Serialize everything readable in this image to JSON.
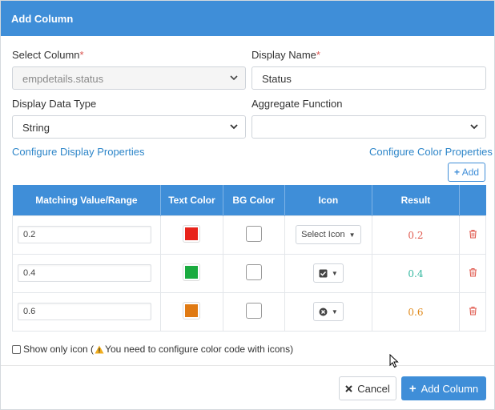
{
  "dialog": {
    "title": "Add Column"
  },
  "form": {
    "select_column_label": "Select Column",
    "select_column_value": "empdetails.status",
    "display_name_label": "Display Name",
    "display_name_value": "Status",
    "display_data_type_label": "Display Data Type",
    "display_data_type_value": "String",
    "aggregate_function_label": "Aggregate Function",
    "aggregate_function_value": "",
    "required_mark": "*",
    "configure_display_link": "Configure Display Properties",
    "configure_color_link": "Configure Color Properties",
    "add_button_label": "Add"
  },
  "table": {
    "headers": [
      "Matching Value/Range",
      "Text Color",
      "BG Color",
      "Icon",
      "Result",
      ""
    ],
    "rows": [
      {
        "value": "0.2",
        "text_color": "#e8231a",
        "bg_color": "#ffffff",
        "icon": "Select Icon",
        "icon_name": "none",
        "result": "0.2",
        "result_color": "#e05a4f"
      },
      {
        "value": "0.4",
        "text_color": "#1aab3f",
        "bg_color": "#ffffff",
        "icon": "",
        "icon_name": "check-square-icon",
        "result": "0.4",
        "result_color": "#35b8a0"
      },
      {
        "value": "0.6",
        "text_color": "#e07a13",
        "bg_color": "#ffffff",
        "icon": "",
        "icon_name": "times-circle-icon",
        "result": "0.6",
        "result_color": "#e0891a"
      }
    ]
  },
  "options": {
    "show_only_icon_label_prefix": "Show only icon (",
    "show_only_icon_label_suffix": " You need to configure color code with icons)"
  },
  "footer": {
    "cancel_label": "Cancel",
    "add_column_label": "Add Column"
  },
  "colors": {
    "accent": "#3f8ed8",
    "link": "#2e86c9",
    "danger": "#d9534f"
  }
}
